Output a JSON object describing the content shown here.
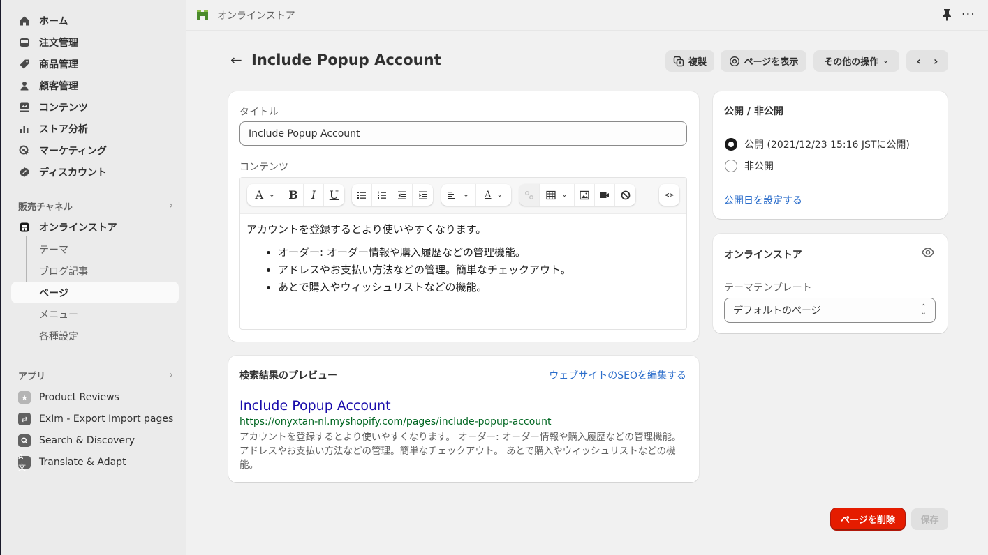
{
  "sidebar": {
    "main_items": [
      {
        "label": "ホーム",
        "icon": "home-icon"
      },
      {
        "label": "注文管理",
        "icon": "inbox-icon"
      },
      {
        "label": "商品管理",
        "icon": "tag-icon"
      },
      {
        "label": "顧客管理",
        "icon": "person-icon"
      },
      {
        "label": "コンテンツ",
        "icon": "content-icon"
      },
      {
        "label": "ストア分析",
        "icon": "bar-chart-icon"
      },
      {
        "label": "マーケティング",
        "icon": "target-icon"
      },
      {
        "label": "ディスカウント",
        "icon": "discount-icon"
      }
    ],
    "sales_channels": {
      "heading": "販売チャネル",
      "channel": {
        "label": "オンラインストア",
        "icon": "store-icon"
      },
      "sub_items": [
        {
          "label": "テーマ",
          "active": false
        },
        {
          "label": "ブログ記事",
          "active": false
        },
        {
          "label": "ページ",
          "active": true
        },
        {
          "label": "メニュー",
          "active": false
        },
        {
          "label": "各種設定",
          "active": false
        }
      ]
    },
    "apps": {
      "heading": "アプリ",
      "items": [
        {
          "label": "Product Reviews",
          "icon": "star-icon"
        },
        {
          "label": "ExIm - Export Import pages",
          "icon": "export-import-icon"
        },
        {
          "label": "Search & Discovery",
          "icon": "search-icon"
        },
        {
          "label": "Translate & Adapt",
          "icon": "translate-icon"
        }
      ]
    }
  },
  "topbar": {
    "store_name": "オンラインストア"
  },
  "header": {
    "title": "Include Popup Account",
    "duplicate_label": "複製",
    "view_page_label": "ページを表示",
    "more_actions_label": "その他の操作"
  },
  "content_card": {
    "title_label": "タイトル",
    "title_value": "Include Popup Account",
    "content_label": "コンテンツ",
    "body_intro": "アカウントを登録するとより使いやすくなります。",
    "body_bullets": [
      "オーダー: オーダー情報や購入履歴などの管理機能。",
      "アドレスやお支払い方法などの管理。簡単なチェックアウト。",
      "あとで購入やウィッシュリストなどの機能。"
    ]
  },
  "seo_card": {
    "heading": "検索結果のプレビュー",
    "edit_link": "ウェブサイトのSEOを編集する",
    "preview_title": "Include Popup Account",
    "preview_url": "https://onyxtan-nl.myshopify.com/pages/include-popup-account",
    "preview_description": "アカウントを登録するとより使いやすくなります。 オーダー: オーダー情報や購入履歴などの管理機能。 アドレスやお支払い方法などの管理。簡単なチェックアウト。 あとで購入やウィッシュリストなどの機能。"
  },
  "visibility_card": {
    "heading": "公開 / 非公開",
    "options": [
      {
        "label": "公開 (2021/12/23 15:16 JSTに公開)",
        "selected": true
      },
      {
        "label": "非公開",
        "selected": false
      }
    ],
    "set_date_link": "公開日を設定する"
  },
  "online_store_card": {
    "heading": "オンラインストア",
    "template_label": "テーマテンプレート",
    "template_value": "デフォルトのページ"
  },
  "footer": {
    "delete_label": "ページを削除",
    "save_label": "保存"
  },
  "colors": {
    "delete_button": "#e51c00",
    "link": "#2c6ecb",
    "seo_title": "#1a0dab",
    "seo_url": "#006621"
  }
}
